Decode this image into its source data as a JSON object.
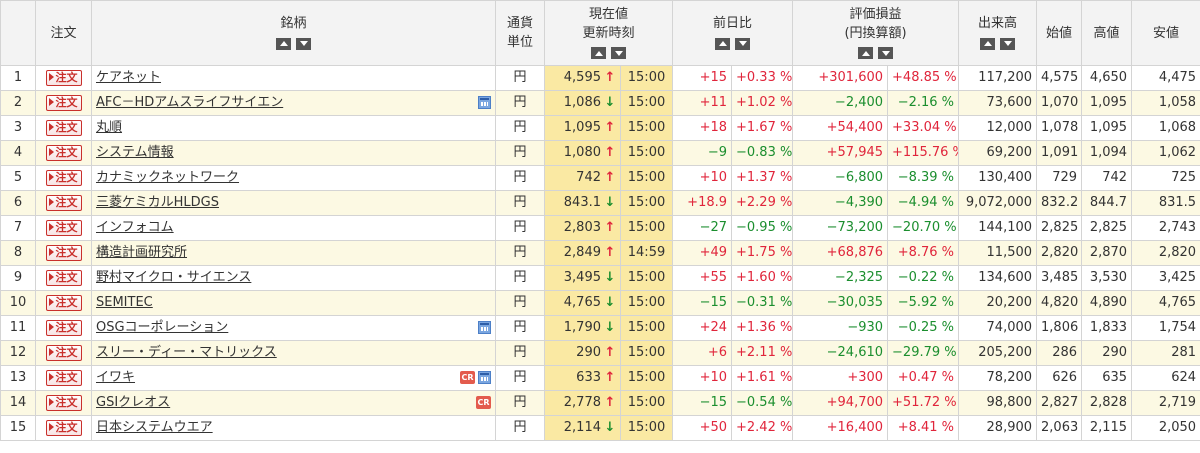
{
  "headers": {
    "order": "注文",
    "name": "銘柄",
    "currency_1": "通貨",
    "currency_2": "単位",
    "price_1": "現在値",
    "price_2": "更新時刻",
    "change": "前日比",
    "pl_1": "評価損益",
    "pl_2": "(円換算額)",
    "volume": "出来高",
    "open": "始値",
    "high": "高値",
    "low": "安値"
  },
  "order_label": "注文",
  "currency_value": "円",
  "icons": {
    "up": "▲",
    "down": "▼",
    "calendar": "calendar-icon",
    "cr_label": "CR"
  },
  "rows": [
    {
      "no": "1",
      "name": "ケアネット",
      "price": "4,595",
      "dir": "up",
      "time": "15:00",
      "chg": "+15",
      "chgp": "+0.33 %",
      "pl": "+301,600",
      "plp": "+48.85 %",
      "vol": "117,200",
      "open": "4,575",
      "high": "4,650",
      "low": "4,475",
      "cal": false,
      "cr": false
    },
    {
      "no": "2",
      "name": "AFC－HDアムスライフサイエン",
      "price": "1,086",
      "dir": "down",
      "time": "15:00",
      "chg": "+11",
      "chgp": "+1.02 %",
      "pl": "−2,400",
      "plp": "−2.16 %",
      "vol": "73,600",
      "open": "1,070",
      "high": "1,095",
      "low": "1,058",
      "cal": true,
      "cr": false
    },
    {
      "no": "3",
      "name": "丸順",
      "price": "1,095",
      "dir": "up",
      "time": "15:00",
      "chg": "+18",
      "chgp": "+1.67 %",
      "pl": "+54,400",
      "plp": "+33.04 %",
      "vol": "12,000",
      "open": "1,078",
      "high": "1,095",
      "low": "1,068",
      "cal": false,
      "cr": false
    },
    {
      "no": "4",
      "name": "システム情報",
      "price": "1,080",
      "dir": "up",
      "time": "15:00",
      "chg": "−9",
      "chgp": "−0.83 %",
      "pl": "+57,945",
      "plp": "+115.76 %",
      "vol": "69,200",
      "open": "1,091",
      "high": "1,094",
      "low": "1,062",
      "cal": false,
      "cr": false
    },
    {
      "no": "5",
      "name": "カナミックネットワーク",
      "price": "742",
      "dir": "up",
      "time": "15:00",
      "chg": "+10",
      "chgp": "+1.37 %",
      "pl": "−6,800",
      "plp": "−8.39 %",
      "vol": "130,400",
      "open": "729",
      "high": "742",
      "low": "725",
      "cal": false,
      "cr": false
    },
    {
      "no": "6",
      "name": "三菱ケミカルHLDGS",
      "price": "843.1",
      "dir": "down",
      "time": "15:00",
      "chg": "+18.9",
      "chgp": "+2.29 %",
      "pl": "−4,390",
      "plp": "−4.94 %",
      "vol": "9,072,000",
      "open": "832.2",
      "high": "844.7",
      "low": "831.5",
      "cal": false,
      "cr": false
    },
    {
      "no": "7",
      "name": "インフォコム",
      "price": "2,803",
      "dir": "up",
      "time": "15:00",
      "chg": "−27",
      "chgp": "−0.95 %",
      "pl": "−73,200",
      "plp": "−20.70 %",
      "vol": "144,100",
      "open": "2,825",
      "high": "2,825",
      "low": "2,743",
      "cal": false,
      "cr": false
    },
    {
      "no": "8",
      "name": "構造計画研究所",
      "price": "2,849",
      "dir": "up",
      "time": "14:59",
      "chg": "+49",
      "chgp": "+1.75 %",
      "pl": "+68,876",
      "plp": "+8.76 %",
      "vol": "11,500",
      "open": "2,820",
      "high": "2,870",
      "low": "2,820",
      "cal": false,
      "cr": false
    },
    {
      "no": "9",
      "name": "野村マイクロ・サイエンス",
      "price": "3,495",
      "dir": "down",
      "time": "15:00",
      "chg": "+55",
      "chgp": "+1.60 %",
      "pl": "−2,325",
      "plp": "−0.22 %",
      "vol": "134,600",
      "open": "3,485",
      "high": "3,530",
      "low": "3,425",
      "cal": false,
      "cr": false
    },
    {
      "no": "10",
      "name": "SEMITEC",
      "price": "4,765",
      "dir": "down",
      "time": "15:00",
      "chg": "−15",
      "chgp": "−0.31 %",
      "pl": "−30,035",
      "plp": "−5.92 %",
      "vol": "20,200",
      "open": "4,820",
      "high": "4,890",
      "low": "4,765",
      "cal": false,
      "cr": false
    },
    {
      "no": "11",
      "name": "OSGコーポレーション",
      "price": "1,790",
      "dir": "down",
      "time": "15:00",
      "chg": "+24",
      "chgp": "+1.36 %",
      "pl": "−930",
      "plp": "−0.25 %",
      "vol": "74,000",
      "open": "1,806",
      "high": "1,833",
      "low": "1,754",
      "cal": true,
      "cr": false
    },
    {
      "no": "12",
      "name": "スリー・ディー・マトリックス",
      "price": "290",
      "dir": "up",
      "time": "15:00",
      "chg": "+6",
      "chgp": "+2.11 %",
      "pl": "−24,610",
      "plp": "−29.79 %",
      "vol": "205,200",
      "open": "286",
      "high": "290",
      "low": "281",
      "cal": false,
      "cr": false
    },
    {
      "no": "13",
      "name": "イワキ",
      "price": "633",
      "dir": "up",
      "time": "15:00",
      "chg": "+10",
      "chgp": "+1.61 %",
      "pl": "+300",
      "plp": "+0.47 %",
      "vol": "78,200",
      "open": "626",
      "high": "635",
      "low": "624",
      "cal": true,
      "cr": true
    },
    {
      "no": "14",
      "name": "GSIクレオス",
      "price": "2,778",
      "dir": "up",
      "time": "15:00",
      "chg": "−15",
      "chgp": "−0.54 %",
      "pl": "+94,700",
      "plp": "+51.72 %",
      "vol": "98,800",
      "open": "2,827",
      "high": "2,828",
      "low": "2,719",
      "cal": false,
      "cr": true
    },
    {
      "no": "15",
      "name": "日本システムウエア",
      "price": "2,114",
      "dir": "down",
      "time": "15:00",
      "chg": "+50",
      "chgp": "+2.42 %",
      "pl": "+16,400",
      "plp": "+8.41 %",
      "vol": "28,900",
      "open": "2,063",
      "high": "2,115",
      "low": "2,050",
      "cal": false,
      "cr": false
    }
  ],
  "colors": {
    "positive": "#e0253b",
    "negative": "#1b8e2e",
    "row_alt": "#fcf9e3",
    "price_bg": "#fae9a3",
    "header_bg": "#f3f3f3"
  }
}
